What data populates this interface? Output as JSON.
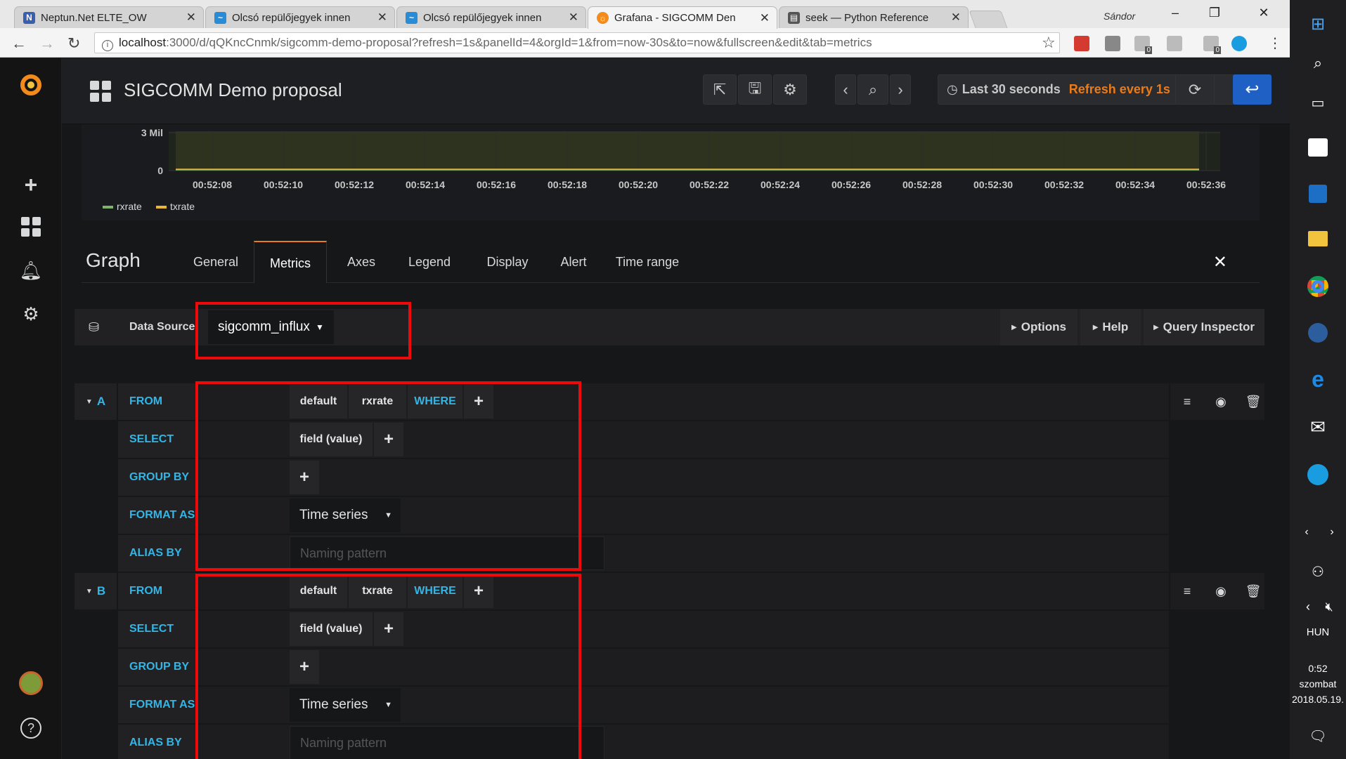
{
  "browser": {
    "tabs": [
      {
        "title": "Neptun.Net ELTE_OW"
      },
      {
        "title": "Olcsó repülőjegyek innen"
      },
      {
        "title": "Olcsó repülőjegyek innen"
      },
      {
        "title": "Grafana - SIGCOMM Den"
      },
      {
        "title": "seek — Python Reference"
      }
    ],
    "user_name": "Sándor",
    "url_host": "localhost",
    "url_path": ":3000/d/qQKncCnmk/sigcomm-demo-proposal?refresh=1s&panelId=4&orgId=1&from=now-30s&to=now&fullscreen&edit&tab=metrics",
    "ext_badge_1": "0",
    "ext_badge_2": "0"
  },
  "taskbar": {
    "language": "HUN",
    "time": "0:52",
    "day": "szombat",
    "date": "2018.05.19."
  },
  "dashboard": {
    "title": "SIGCOMM Demo proposal",
    "time_range": "Last 30 seconds",
    "refresh": "Refresh every 1s"
  },
  "chart_data": {
    "type": "line",
    "x": [
      "00:52:08",
      "00:52:10",
      "00:52:12",
      "00:52:14",
      "00:52:16",
      "00:52:18",
      "00:52:20",
      "00:52:22",
      "00:52:24",
      "00:52:26",
      "00:52:28",
      "00:52:30",
      "00:52:32",
      "00:52:34",
      "00:52:36"
    ],
    "y_ticks": [
      "3 Mil",
      "0"
    ],
    "series": [
      {
        "name": "rxrate",
        "color": "#7eb26d"
      },
      {
        "name": "txrate",
        "color": "#eab839"
      }
    ]
  },
  "editor": {
    "title": "Graph",
    "tabs": [
      "General",
      "Metrics",
      "Axes",
      "Legend",
      "Display",
      "Alert",
      "Time range"
    ],
    "active_tab": "Metrics",
    "datasource_label": "Data Source",
    "datasource_value": "sigcomm_influx",
    "options_label": "Options",
    "help_label": "Help",
    "inspector_label": "Query Inspector"
  },
  "queries": [
    {
      "letter": "A",
      "from_kw": "FROM",
      "policy": "default",
      "measurement": "rxrate",
      "where_kw": "WHERE",
      "select_kw": "SELECT",
      "field": "field (value)",
      "group_kw": "GROUP BY",
      "format_kw": "FORMAT AS",
      "format_value": "Time series",
      "alias_kw": "ALIAS BY",
      "alias_placeholder": "Naming pattern"
    },
    {
      "letter": "B",
      "from_kw": "FROM",
      "policy": "default",
      "measurement": "txrate",
      "where_kw": "WHERE",
      "select_kw": "SELECT",
      "field": "field (value)",
      "group_kw": "GROUP BY",
      "format_kw": "FORMAT AS",
      "format_value": "Time series",
      "alias_kw": "ALIAS BY",
      "alias_placeholder": "Naming pattern"
    }
  ]
}
